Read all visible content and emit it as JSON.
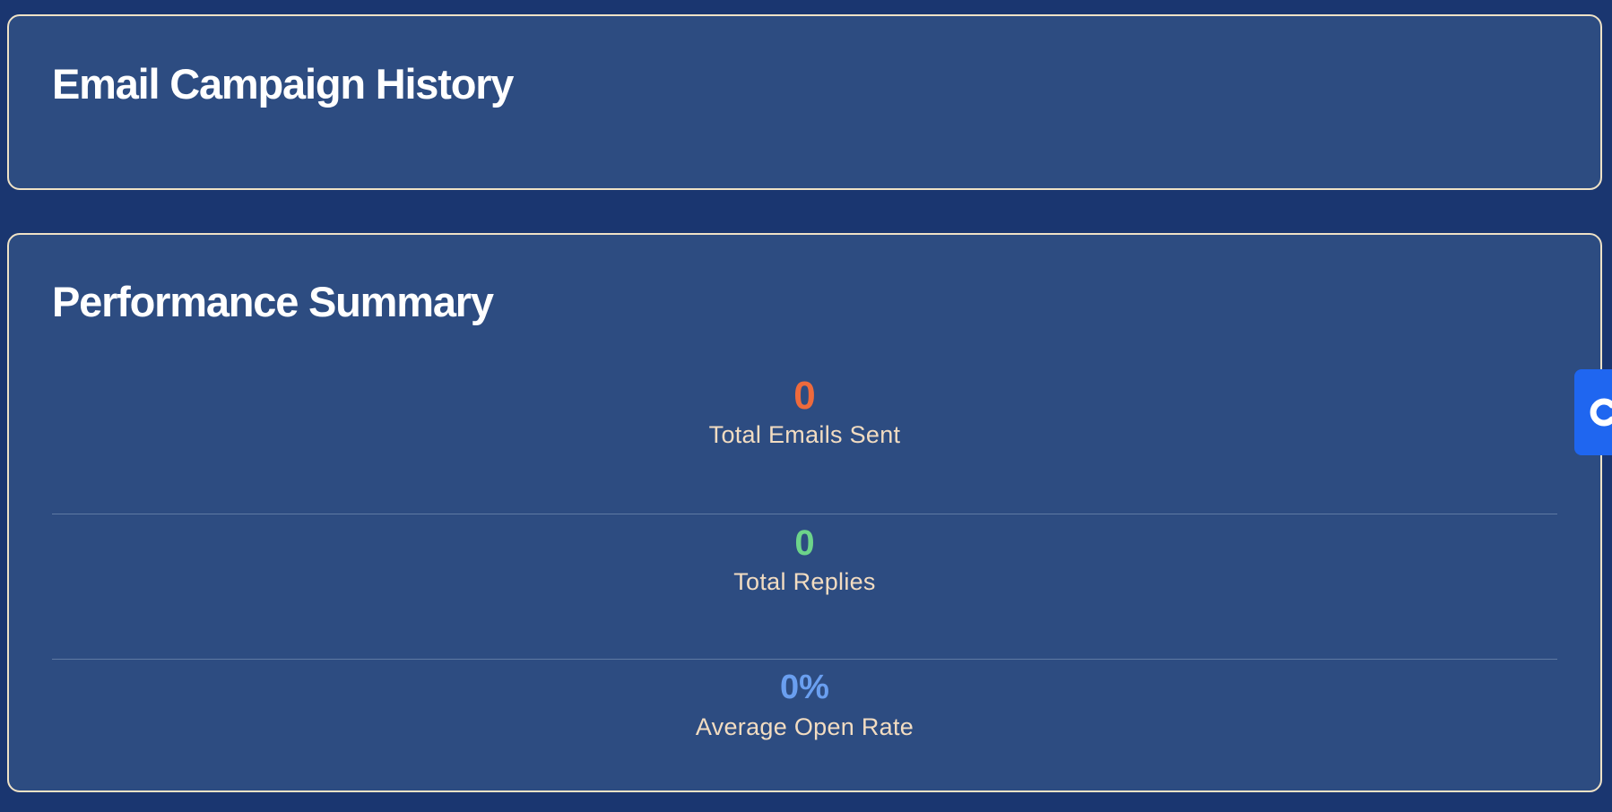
{
  "history": {
    "title": "Email Campaign History"
  },
  "summary": {
    "title": "Performance Summary",
    "stats": [
      {
        "value": "0",
        "label": "Total Emails Sent",
        "color": "#ee6a3c"
      },
      {
        "value": "0",
        "label": "Total Replies",
        "color": "#6dd48a"
      },
      {
        "value": "0%",
        "label": "Average Open Rate",
        "color": "#6a9ff0"
      }
    ]
  },
  "side_tab": {
    "icon": "chat-icon",
    "color": "#1f66f0"
  },
  "colors": {
    "background": "#1a3670",
    "card": "#2d4c81",
    "card_border": "#efe2c6",
    "label": "#f2dcc1"
  }
}
